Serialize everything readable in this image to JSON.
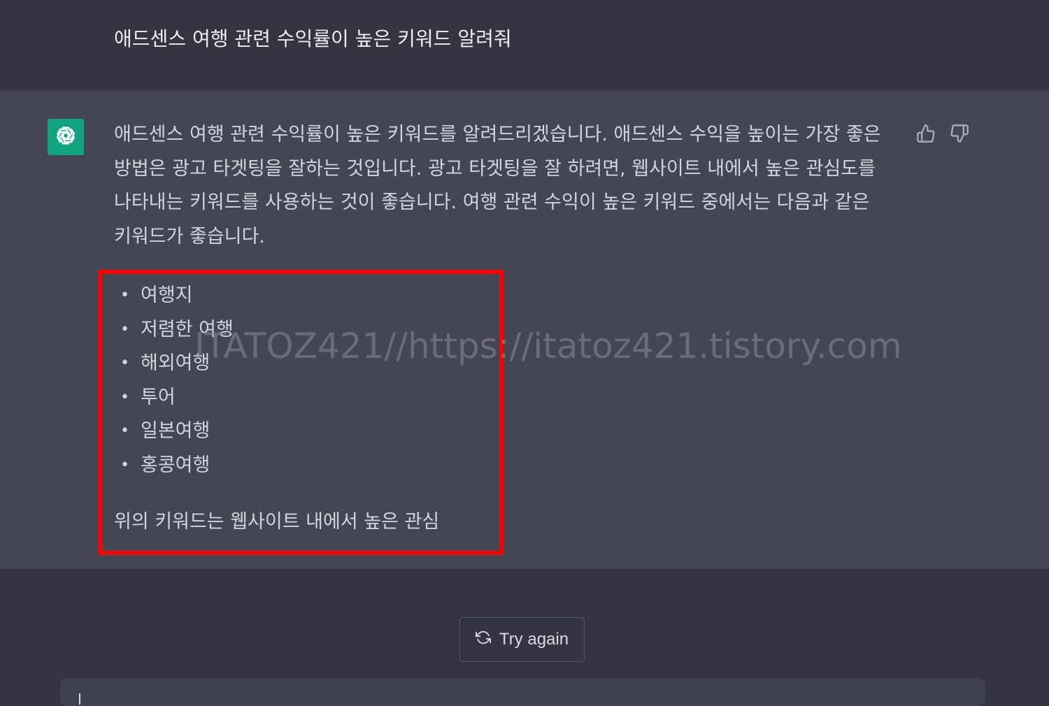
{
  "user_message": "애드센스 여행 관련 수익률이 높은 키워드 알려줘",
  "assistant": {
    "avatar_icon": "openai-logo-icon",
    "answer_paragraph": "애드센스 여행 관련 수익률이 높은 키워드를 알려드리겠습니다. 애드센스 수익을 높이는 가장 좋은 방법은 광고 타겟팅을 잘하는 것입니다. 광고 타겟팅을 잘 하려면, 웹사이트 내에서 높은 관심도를 나타내는 키워드를 사용하는 것이 좋습니다. 여행 관련 수익이 높은 키워드 중에서는 다음과 같은 키워드가 좋습니다.",
    "keywords": [
      "여행지",
      "저렴한 여행",
      "해외여행",
      "투어",
      "일본여행",
      "홍콩여행"
    ],
    "bullet": "•",
    "closing_text": "위의 키워드는 웹사이트 내에서 높은 관심",
    "feedback": {
      "thumbs_up_icon": "thumbs-up-icon",
      "thumbs_down_icon": "thumbs-down-icon"
    }
  },
  "watermark": "ITATOZ421//https://itatoz421.tistory.com",
  "try_again_label": "Try again",
  "colors": {
    "background": "#343541",
    "assistant_background": "#444654",
    "avatar": "#10a37f",
    "highlight_border": "#ff0000",
    "composer": "#40414f"
  }
}
